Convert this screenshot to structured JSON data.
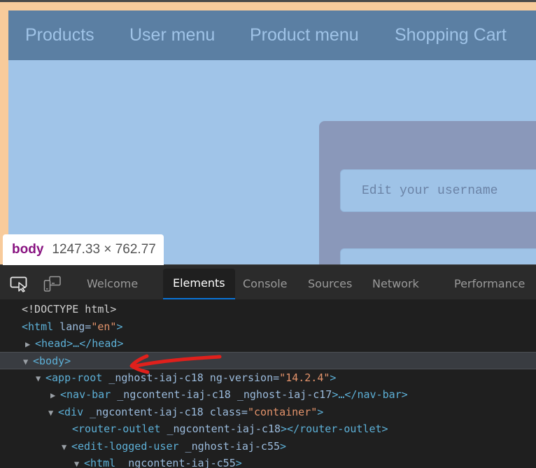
{
  "page": {
    "nav": {
      "items": [
        {
          "label": "Products"
        },
        {
          "label": "User menu"
        },
        {
          "label": "Product menu"
        },
        {
          "label": "Shopping Cart"
        }
      ]
    },
    "form": {
      "username_placeholder": "Edit your username",
      "second_field_placeholder": ""
    },
    "colors": {
      "page_border": "#f8cb9b",
      "navbar_bg": "#5b7fa3",
      "nav_text": "#9fc3e7",
      "page_bg": "#a0c4e8",
      "card_bg": "#8a98ba"
    }
  },
  "tooltip": {
    "tag": "body",
    "dimensions": "1247.33 × 762.77"
  },
  "devtools": {
    "icons": [
      "inspect-element-icon",
      "device-toolbar-icon"
    ],
    "tabs": [
      {
        "label": "Welcome",
        "active": false
      },
      {
        "label": "Elements",
        "active": true
      },
      {
        "label": "Console",
        "active": false
      },
      {
        "label": "Sources",
        "active": false
      },
      {
        "label": "Network",
        "active": false
      },
      {
        "label": "Performance",
        "active": false
      }
    ],
    "dom": {
      "doctype": "<!DOCTYPE html>",
      "html_open": "<html",
      "html_attr": " lang=",
      "html_val": "\"en\"",
      "html_close": ">",
      "head": "<head>…</head>",
      "body": "<body>",
      "app_root_open": "<app-root",
      "app_root_attr": " _nghost-iaj-c18 ng-version=",
      "app_root_val": "\"14.2.4\"",
      "app_root_close": ">",
      "nav_bar_open": "<nav-bar",
      "nav_bar_attr": " _ngcontent-iaj-c18 _nghost-iaj-c17",
      "nav_bar_close": ">…</nav-bar>",
      "div_open": "<div",
      "div_attr": " _ngcontent-iaj-c18 class=",
      "div_val": "\"container\"",
      "div_close": ">",
      "router_open": "<router-outlet",
      "router_attr": " _ngcontent-iaj-c18",
      "router_close": "></router-outlet>",
      "edit_open": "<edit-logged-user",
      "edit_attr": " _nghost-iaj-c55",
      "edit_close": ">",
      "inner_html_open": "<html",
      "inner_html_attr": " _ngcontent-iaj-c55",
      "inner_html_close": ">"
    },
    "colors": {
      "active_tab_underline": "#0a74d8",
      "annotation_arrow": "#e0201c"
    }
  }
}
